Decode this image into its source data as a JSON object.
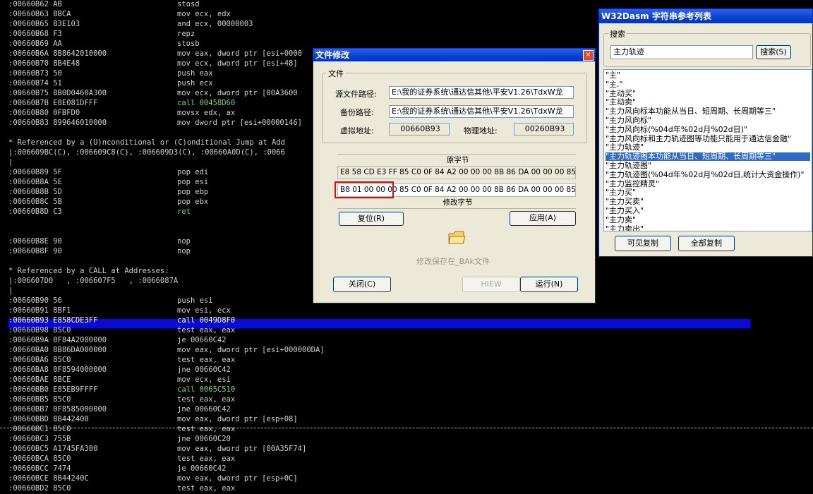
{
  "listing": [
    {
      "a": ":00660B62 AB",
      "m": "stosd"
    },
    {
      "a": ":00660B63 8BCA",
      "m": "mov ecx, edx"
    },
    {
      "a": ":00660B65 83E103",
      "m": "and ecx, 00000003"
    },
    {
      "a": ":00660B68 F3",
      "m": "repz"
    },
    {
      "a": ":00660B69 AA",
      "m": "stosb"
    },
    {
      "a": ":00660B6A 8B8642010000",
      "m": "mov eax, dword ptr [esi+0000"
    },
    {
      "a": ":00660B70 8B4E48",
      "m": "mov ecx, dword ptr [esi+48]"
    },
    {
      "a": ":00660B73 50",
      "m": "push eax"
    },
    {
      "a": ":00660B74 51",
      "m": "push ecx"
    },
    {
      "a": ":00660B75 8B0D0460A300",
      "m": "mov ecx, dword ptr [00A3600"
    },
    {
      "a": ":00660B7B E8E081DFFF",
      "m": "call 00458D60",
      "c": "call"
    },
    {
      "a": ":00660B80 0FBFD0",
      "m": "movsx edx, ax"
    },
    {
      "a": ":00660B83 899646010000",
      "m": "mov dword ptr [esi+00000146]"
    },
    {
      "a": "",
      "m": ""
    },
    {
      "a": "* Referenced by a (U)nconditional or (C)onditional Jump at Add",
      "m": ""
    },
    {
      "a": "|:006609BC(C), :006609C8(C), :006609D3(C), :00660A0D(C), :0066",
      "m": ""
    },
    {
      "a": "|",
      "m": ""
    },
    {
      "a": ":00660B89 5F",
      "m": "pop edi"
    },
    {
      "a": ":00660B8A 5E",
      "m": "pop esi"
    },
    {
      "a": ":00660B8B 5D",
      "m": "pop ebp"
    },
    {
      "a": ":00660B8C 5B",
      "m": "pop ebx"
    },
    {
      "a": ":00660B8D C3",
      "m": "ret",
      "c": "ret"
    },
    {
      "a": "",
      "m": ""
    },
    {
      "a": "",
      "m": ""
    },
    {
      "a": ":00660B8E 90",
      "m": "nop"
    },
    {
      "a": ":00660B8F 90",
      "m": "nop"
    },
    {
      "a": "",
      "m": ""
    },
    {
      "a": "* Referenced by a CALL at Addresses:",
      "m": ""
    },
    {
      "a": "|:006607D0   , :006607F5   , :0066087A",
      "m": ""
    },
    {
      "a": "|",
      "m": ""
    },
    {
      "a": ":00660B90 56",
      "m": "push esi"
    },
    {
      "a": ":00660B91 8BF1",
      "m": "mov esi, ecx"
    },
    {
      "a": ":00660B93 E858CDE3FF",
      "m": "call 0049D8F0",
      "c": "call",
      "sel": true
    },
    {
      "a": ":00660B98 85C0",
      "m": "test eax, eax"
    },
    {
      "a": ":00660B9A 0F84A2000000",
      "m": "je 00660C42"
    },
    {
      "a": ":00660BA0 8B86DA000000",
      "m": "mov eax, dword ptr [esi+000000DA]"
    },
    {
      "a": ":00660BA6 85C0",
      "m": "test eax, eax"
    },
    {
      "a": ":00660BA8 0F8594000000",
      "m": "jne 00660C42"
    },
    {
      "a": ":00660BAE 8BCE",
      "m": "mov ecx, esi"
    },
    {
      "a": ":00660BB0 E85EB9FFFF",
      "m": "call 0065C510",
      "c": "call"
    },
    {
      "a": ":00660BB5 85C0",
      "m": "test eax, eax"
    },
    {
      "a": ":00660BB7 0F8585000000",
      "m": "jne 00660C42"
    },
    {
      "a": ":00660BBD 8B442408",
      "m": "mov eax, dword ptr [esp+08]"
    },
    {
      "a": ":00660BC1 85C0",
      "m": "test eax, eax"
    },
    {
      "a": ":00660BC3 755B",
      "m": "jne 00660C20"
    },
    {
      "a": ":00660BC5 A1745FA300",
      "m": "mov eax, dword ptr [00A35F74]"
    },
    {
      "a": ":00660BCA 85C0",
      "m": "test eax, eax"
    },
    {
      "a": ":00660BCC 7474",
      "m": "je 00660C42"
    },
    {
      "a": ":00660BCE 8B44240C",
      "m": "mov eax, dword ptr [esp+0C]"
    },
    {
      "a": ":00660BD2 85C0",
      "m": "test eax, eax"
    }
  ],
  "file_dialog": {
    "title": "文件修改",
    "close": "×",
    "group_file": "文件",
    "src_label": "源文件路径:",
    "src_value": "E:\\我的证券系统\\通达信其他\\平安V1.26\\TdxW龙",
    "bak_label": "备份路径:",
    "bak_value": "E:\\我的证券系统\\通达信其他\\平安V1.26\\TdxW龙",
    "va_label": "虚拟地址:",
    "va_value": "00660B93",
    "pa_label": "物理地址:",
    "pa_value": "00260B93",
    "orig_header": "原字节",
    "orig_bytes": "E8 58 CD E3 FF 85 C0 0F 84 A2 00 00 00 8B 86 DA 00 00 00 85",
    "mod_bytes": "B8 01 00 00 00 85 C0 0F 84 A2 00 00 00 8B 86 DA 00 00 00 85",
    "mod_header": "修改字节",
    "reset_btn": "复位(R)",
    "apply_btn": "应用(A)",
    "saved_text": "修改保存在_BAk文件",
    "close_btn": "关闭(C)",
    "hiew_btn": "HIEW",
    "run_btn": "运行(N)"
  },
  "string_dialog": {
    "title": "W32Dasm 字符串参考列表",
    "search_group": "搜索",
    "search_value": "主力轨迹",
    "search_btn": "搜索(S)",
    "items": [
      "\"主\"",
      "\"主.\"",
      "\"主动买\"",
      "\"主动卖\"",
      "\"主力风向标本功能从当日、短周期、长周期等三\"",
      "\"主力风向标\"",
      "\"主力风向标(%04d年%02d月%02d日)\"",
      "\"主力风向标和主力轨迹图等功能只能用于通达信金融\"",
      "\"主力轨迹\"",
      "\"主力轨迹图本功能从当日、短周期、长周期等三\"",
      "\"主力轨迹图\"",
      "\"主力轨迹图(%04d年%02d月%02d日,统计大资金操作)\"",
      "\"主力监控精灵\"",
      "\"主力买\"",
      "\"主力买卖\"",
      "\"主力买入\"",
      "\"主力卖\"",
      "\"主力卖出\""
    ],
    "selected_index": 9,
    "copy_visible_btn": "可见复制",
    "copy_all_btn": "全部复制"
  }
}
